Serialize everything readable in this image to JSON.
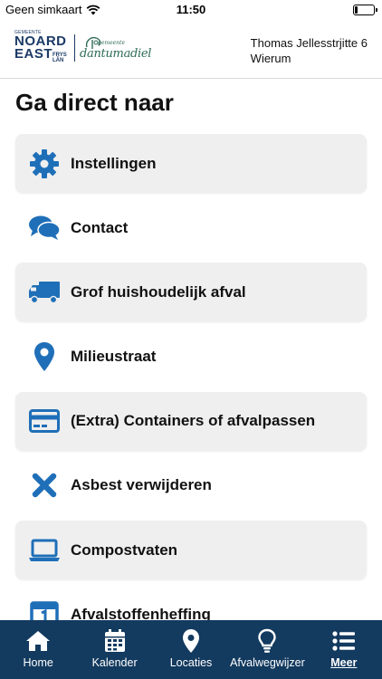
{
  "status_bar": {
    "carrier": "Geen simkaart",
    "time": "11:50",
    "battery_level": 0.15
  },
  "header": {
    "logo_left": {
      "small_text": "GEMEENTE",
      "line1": "NOARD",
      "line2": "EAST",
      "side1": "FRYS",
      "side2": "LÂN"
    },
    "logo_right": {
      "small_text": "gemeente",
      "name": "dantumadiel"
    },
    "address_line1": "Thomas Jellesstrjitte 6",
    "address_line2": "Wierum"
  },
  "main": {
    "title": "Ga direct naar",
    "items": [
      {
        "label": "Instellingen",
        "icon": "gear-icon",
        "shaded": true
      },
      {
        "label": "Contact",
        "icon": "chat-bubbles-icon",
        "shaded": false
      },
      {
        "label": "Grof huishoudelijk afval",
        "icon": "truck-icon",
        "shaded": true
      },
      {
        "label": "Milieustraat",
        "icon": "map-pin-icon",
        "shaded": false
      },
      {
        "label": "(Extra) Containers of afvalpassen",
        "icon": "credit-card-icon",
        "shaded": true
      },
      {
        "label": "Asbest verwijderen",
        "icon": "close-x-icon",
        "shaded": false
      },
      {
        "label": "Compostvaten",
        "icon": "laptop-icon",
        "shaded": true
      },
      {
        "label": "Afvalstoffenheffing",
        "icon": "calendar-one-icon",
        "shaded": false
      }
    ]
  },
  "bottom_nav": {
    "items": [
      {
        "label": "Home",
        "icon": "home-icon"
      },
      {
        "label": "Kalender",
        "icon": "calendar-icon"
      },
      {
        "label": "Locaties",
        "icon": "map-pin-icon"
      },
      {
        "label": "Afvalwegwijzer",
        "icon": "lightbulb-icon"
      },
      {
        "label": "Meer",
        "icon": "list-icon",
        "active": true
      }
    ]
  },
  "colors": {
    "primary": "#133a5f",
    "icon_blue": "#1f6fb8",
    "item_shade": "#efefef",
    "logo_navy": "#1b3a66",
    "logo_green": "#2e6b57"
  }
}
